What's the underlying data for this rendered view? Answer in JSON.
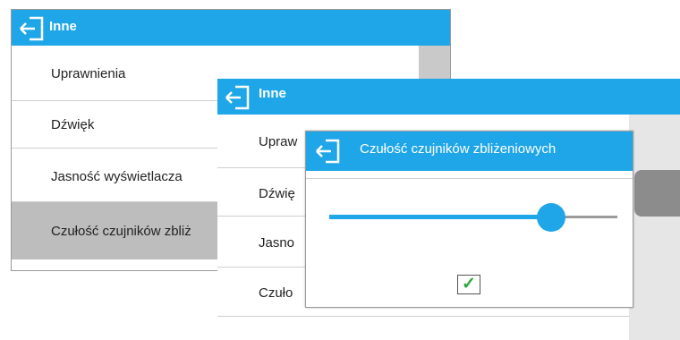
{
  "panel_back": {
    "title": "Inne",
    "items": [
      {
        "label": "Uprawnienia"
      },
      {
        "label": "Dźwięk"
      },
      {
        "label": "Jasność wyświetlacza"
      },
      {
        "label": "Czułość czujników zbliż"
      }
    ]
  },
  "panel_middle": {
    "title": "Inne",
    "items": [
      {
        "label": "Upraw"
      },
      {
        "label": "Dźwię"
      },
      {
        "label": "Jasno"
      },
      {
        "label": "Czuło"
      }
    ]
  },
  "dialog": {
    "title": "Czułość czujników zbliżeniowych",
    "slider_value": 0.77,
    "confirm": "✓"
  },
  "colors": {
    "accent": "#1fa6e8",
    "selected_row": "#bdbdbd",
    "check": "#2fa53a"
  },
  "icons": {
    "back": "exit-arrow-icon",
    "confirm": "checkmark-icon"
  }
}
